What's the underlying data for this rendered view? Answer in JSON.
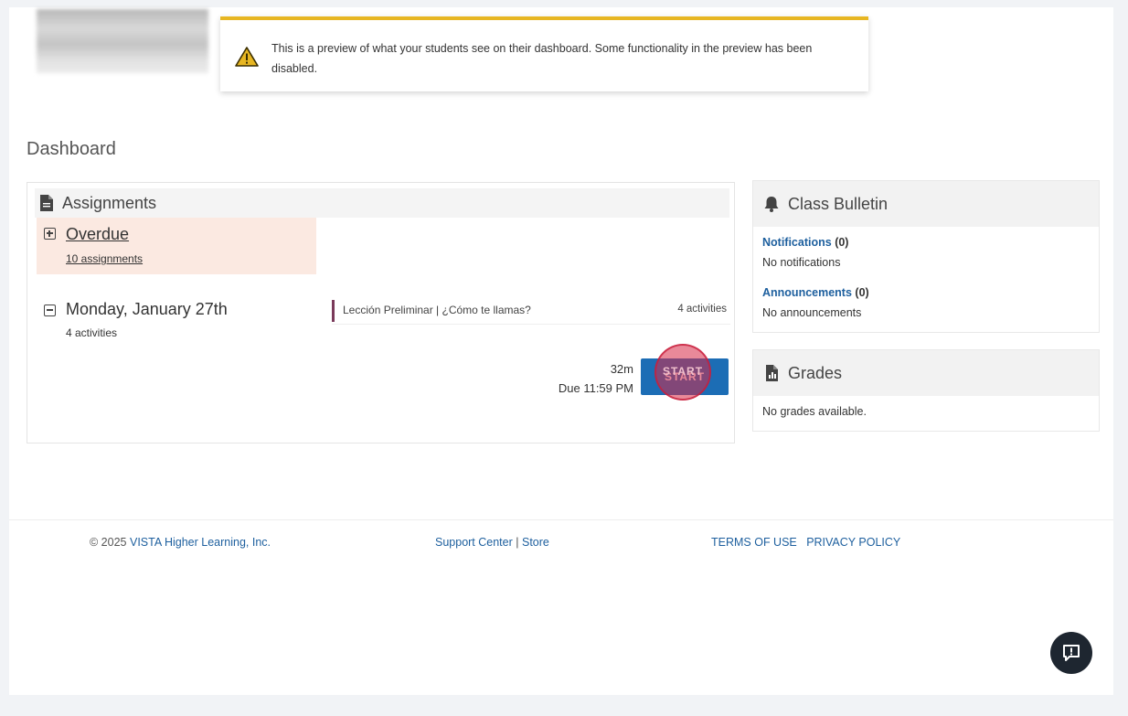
{
  "notice": {
    "text": "This is a preview of what your students see on their dashboard. Some functionality in the preview has been disabled."
  },
  "page_title": "Dashboard",
  "assignments": {
    "title": "Assignments",
    "overdue": {
      "label": "Overdue",
      "count": "10 assignments"
    },
    "day": {
      "label": "Monday, January 27th",
      "count": "4 activities",
      "lesson": {
        "name": "Lección Preliminar | ¿Cómo te llamas?",
        "activities": "4 activities"
      },
      "duration": "32m",
      "due": "Due 11:59 PM",
      "start_label": "START"
    }
  },
  "bulletin": {
    "title": "Class Bulletin",
    "notifications_label": "Notifications",
    "notifications_count": "(0)",
    "notifications_empty": "No notifications",
    "announcements_label": "Announcements",
    "announcements_count": "(0)",
    "announcements_empty": "No announcements"
  },
  "grades": {
    "title": "Grades",
    "empty": "No grades available."
  },
  "footer": {
    "copyright_prefix": "© 2025",
    "company": "VISTA Higher Learning, Inc.",
    "support": "Support Center",
    "separator": "|",
    "store": "Store",
    "terms": "TERMS OF USE",
    "privacy": "PRIVACY POLICY"
  },
  "colors": {
    "accent_blue": "#1c6db5",
    "warning_yellow": "#e7b622",
    "overdue_bg": "#fbe9e1",
    "link_blue": "#1d5f9e"
  },
  "icons": {
    "notice": "warning-triangle-icon",
    "assignments": "document-icon",
    "bulletin": "bell-icon",
    "grades": "grades-document-icon",
    "help": "chat-help-icon"
  }
}
